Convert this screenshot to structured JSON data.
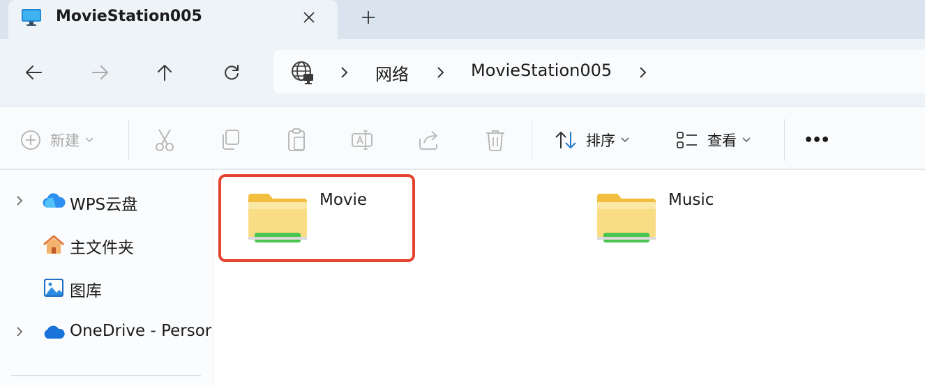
{
  "window": {
    "tab_title": "MovieStation005",
    "icons": {
      "tab": "computer-monitor-icon",
      "close": "close-icon",
      "new_tab": "plus-icon"
    }
  },
  "navigation": {
    "buttons": [
      "back",
      "forward",
      "up",
      "refresh"
    ],
    "breadcrumb": [
      "网络",
      "MovieStation005"
    ],
    "icons": {
      "location": "network-globe-icon",
      "separator": "chevron-right-icon"
    }
  },
  "toolbar": {
    "new_label": "新建",
    "sort_label": "排序",
    "view_label": "查看",
    "more_label": "•••",
    "disabled_actions": [
      "cut",
      "copy",
      "paste",
      "rename",
      "share",
      "delete"
    ]
  },
  "sidebar": {
    "items": [
      {
        "label": "WPS云盘",
        "icon": "cloud-icon",
        "expandable": true
      },
      {
        "label": "主文件夹",
        "icon": "home-icon",
        "expandable": false
      },
      {
        "label": "图库",
        "icon": "gallery-icon",
        "expandable": false
      },
      {
        "label": "OneDrive - Persor",
        "icon": "onedrive-cloud-icon",
        "expandable": true
      }
    ]
  },
  "content": {
    "folders": [
      {
        "name": "Movie",
        "icon": "shared-folder-icon",
        "highlighted": true
      },
      {
        "name": "Music",
        "icon": "shared-folder-icon",
        "highlighted": false
      }
    ]
  },
  "colors": {
    "highlight_border": "#e5432f",
    "folder_yellow": "#f7d77a",
    "folder_share_bar": "#4bc552",
    "accent_blue": "#1f7ad6"
  }
}
